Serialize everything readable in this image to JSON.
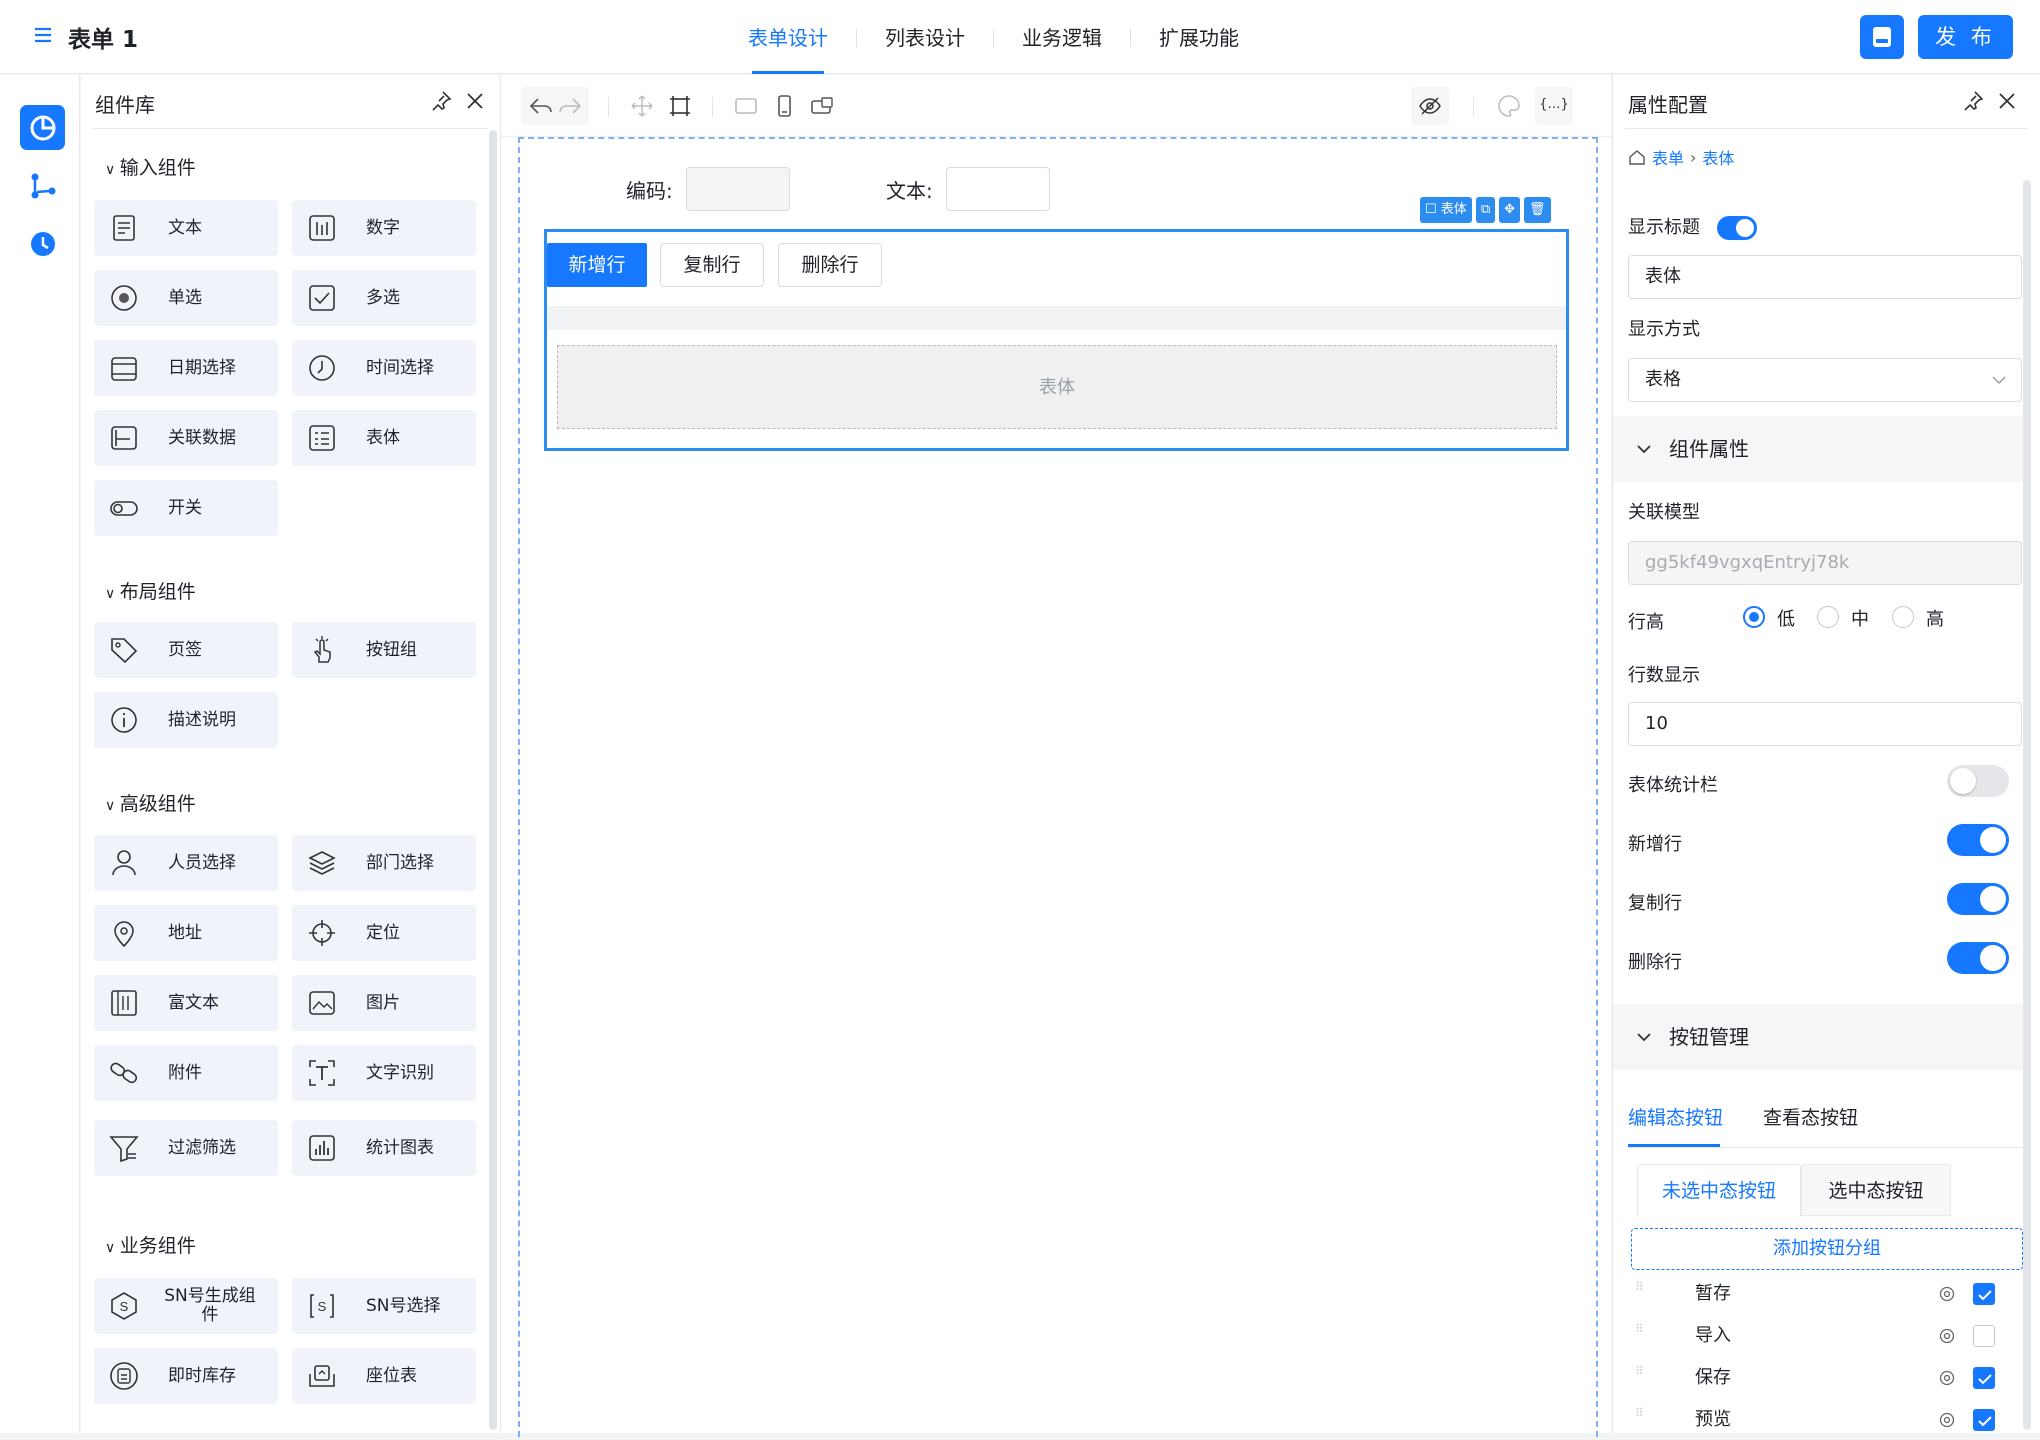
{
  "header": {
    "title": "表单 1",
    "tabs": [
      "表单设计",
      "列表设计",
      "业务逻辑",
      "扩展功能"
    ],
    "active_tab": 0,
    "publish_label": "发 布"
  },
  "library": {
    "title": "组件库",
    "sections": [
      {
        "title": "输入组件",
        "items": [
          "文本",
          "数字",
          "单选",
          "多选",
          "日期选择",
          "时间选择",
          "关联数据",
          "表体",
          "开关"
        ]
      },
      {
        "title": "布局组件",
        "items": [
          "页签",
          "按钮组",
          "描述说明"
        ]
      },
      {
        "title": "高级组件",
        "items": [
          "人员选择",
          "部门选择",
          "地址",
          "定位",
          "富文本",
          "图片",
          "附件",
          "文字识别",
          "过滤筛选",
          "统计图表"
        ]
      },
      {
        "title": "业务组件",
        "items": [
          "SN号生成组件",
          "SN号选择",
          "即时库存",
          "座位表"
        ]
      }
    ]
  },
  "canvas": {
    "field_code_label": "编码:",
    "field_text_label": "文本:",
    "table": {
      "tag_label": "表体",
      "add_row": "新增行",
      "copy_row": "复制行",
      "delete_row": "删除行",
      "placeholder": "表体"
    }
  },
  "props": {
    "title": "属性配置",
    "breadcrumb": [
      "表单",
      "表体"
    ],
    "show_title_label": "显示标题",
    "show_title": true,
    "title_value": "表体",
    "display_mode_label": "显示方式",
    "display_mode": "表格",
    "component_props_title": "组件属性",
    "model_label": "关联模型",
    "model_value": "gg5kf49vgxqEntryj78k",
    "row_height_label": "行高",
    "row_height_options": [
      "低",
      "中",
      "高"
    ],
    "row_height_selected": "低",
    "rows_label": "行数显示",
    "rows_value": "10",
    "stats_label": "表体统计栏",
    "stats_on": false,
    "add_row_label": "新增行",
    "add_row_on": true,
    "copy_row_label": "复制行",
    "copy_row_on": true,
    "delete_row_label": "删除行",
    "delete_row_on": true,
    "button_mgmt_title": "按钮管理",
    "state_tabs": [
      "编辑态按钮",
      "查看态按钮"
    ],
    "select_tabs": [
      "未选中态按钮",
      "选中态按钮"
    ],
    "add_group_label": "添加按钮分组",
    "buttons": [
      {
        "name": "暂存",
        "checked": true
      },
      {
        "name": "导入",
        "checked": false
      },
      {
        "name": "保存",
        "checked": true
      },
      {
        "name": "预览",
        "checked": true
      }
    ]
  },
  "colors": {
    "accent": "#1677ff",
    "table_border": "#2d8cf0"
  }
}
